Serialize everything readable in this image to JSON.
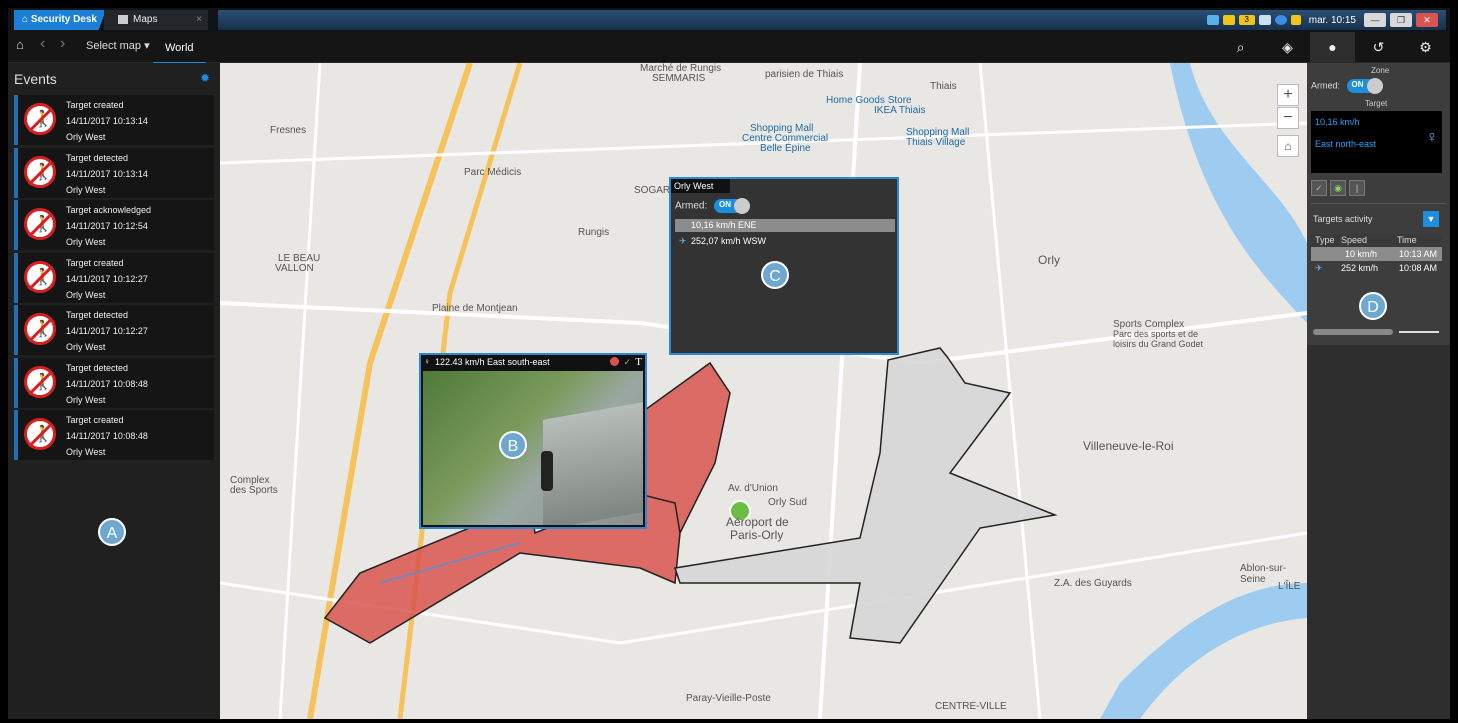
{
  "tabs": {
    "security_desk": "Security Desk",
    "maps": "Maps",
    "close": "×"
  },
  "tray": {
    "clock": "mar. 10:15",
    "badge": "3"
  },
  "toolbar": {
    "home": "⌂",
    "back": "‹",
    "forward": "›",
    "select_map": "Select map ▾",
    "world": "World",
    "search_icon": "⌕",
    "layers_icon": "◈",
    "zone_icon": "●",
    "history_icon": "↺",
    "settings_icon": "⚙"
  },
  "events": {
    "title": "Events",
    "items": [
      {
        "title": "Target created",
        "time": "14/11/2017 10:13:14",
        "zone": "Orly West"
      },
      {
        "title": "Target detected",
        "time": "14/11/2017 10:13:14",
        "zone": "Orly West"
      },
      {
        "title": "Target acknowledged",
        "time": "14/11/2017 10:12:54",
        "zone": "Orly West"
      },
      {
        "title": "Target created",
        "time": "14/11/2017 10:12:27",
        "zone": "Orly West"
      },
      {
        "title": "Target detected",
        "time": "14/11/2017 10:12:27",
        "zone": "Orly West"
      },
      {
        "title": "Target detected",
        "time": "14/11/2017 10:08:48",
        "zone": "Orly West"
      },
      {
        "title": "Target created",
        "time": "14/11/2017 10:08:48",
        "zone": "Orly West"
      }
    ]
  },
  "markers": {
    "a": "A",
    "b": "B",
    "c": "C",
    "d": "D"
  },
  "map": {
    "labels": [
      "Marché de Rungis",
      "SEMMARIS",
      "parisien de Thiais",
      "Thiais",
      "Home Goods Store",
      "IKEA Thiais",
      "Shopping Mall",
      "Centre Commercial",
      "Belle Épine",
      "Shopping Mall",
      "Thiais Village",
      "Fresnes",
      "Parc Médicis",
      "SOGAR",
      "Rungis",
      "LE BEAU",
      "VALLON",
      "Plaine de Montjean",
      "Orly",
      "Sports Complex",
      "Parc des sports et de",
      "loisirs du Grand Godet",
      "Villeneuve-le-Roi",
      "Av. d'Union",
      "Orly Sud",
      "Aéroport de",
      "Paris-Orly",
      "Complex",
      "des Sports",
      "Z.A. des Guyards",
      "Ablon-sur-Seine",
      "L'ÎLE",
      "Paray-Vieille-Poste",
      "CENTRE-VILLE"
    ],
    "zoom_in": "+",
    "zoom_out": "−",
    "home": "⌂"
  },
  "zone_popup": {
    "title": "Orly West",
    "armed_label": "Armed:",
    "toggle": "ON",
    "rows": [
      "10,16 km/h ENE",
      "252,07 km/h WSW"
    ]
  },
  "video_popup": {
    "header": "122.43 km/h East south-east",
    "ack": "✓",
    "text": "T"
  },
  "right_panel": {
    "zone_label": "Zone",
    "armed_label": "Armed:",
    "toggle": "ON",
    "target_label": "Target",
    "target_speed": "10,16 km/h",
    "target_dir": "East north-east",
    "activity_title": "Targets activity",
    "columns": [
      "Type",
      "Speed",
      "Time"
    ],
    "rows": [
      {
        "speed": "10 km/h",
        "time": "10:13 AM"
      },
      {
        "speed": "252 km/h",
        "time": "10:08 AM"
      }
    ]
  }
}
